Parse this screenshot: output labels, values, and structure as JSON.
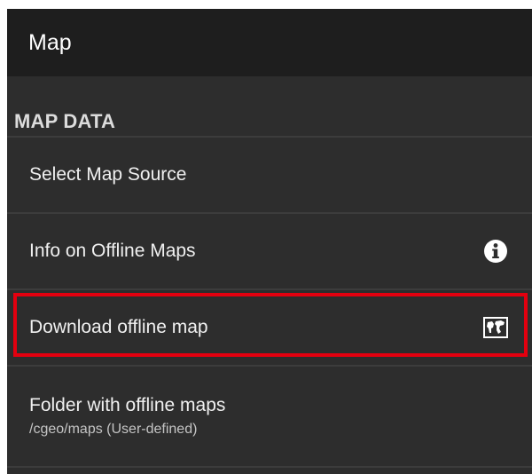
{
  "appbar": {
    "title": "Map"
  },
  "section": {
    "header": "MAP DATA"
  },
  "items": [
    {
      "title": "Select Map Source",
      "icon": null
    },
    {
      "title": "Info on Offline Maps",
      "icon": "info-icon"
    },
    {
      "title": "Download offline map",
      "icon": "world-map-icon",
      "highlighted": true
    },
    {
      "title": "Folder with offline maps",
      "summary": "/cgeo/maps (User-defined)"
    }
  ],
  "colors": {
    "background": "#2d2d2d",
    "appbar": "#1e1e1e",
    "highlight": "#e3000f",
    "text": "#f0f0f0"
  }
}
